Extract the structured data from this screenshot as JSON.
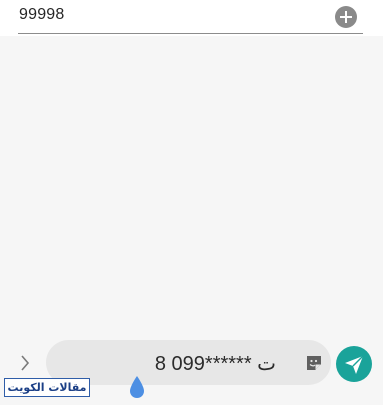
{
  "recipient": {
    "number": "99998",
    "add_icon": "plus-circle-icon"
  },
  "composer": {
    "expand_icon": "chevron-right-icon",
    "message": "ت ******099 8",
    "sticker_icon": "sticker-icon",
    "send_icon": "send-icon"
  },
  "cursor_icon": "text-cursor-handle-icon",
  "watermark": "مقالات الكويت",
  "colors": {
    "background": "#f6f6f6",
    "input_background": "#e7e7e7",
    "send_button": "#1aa39a",
    "add_button": "#8a8a8a",
    "cursor_handle": "#4d8fe3",
    "watermark_border": "#2f5da8"
  }
}
